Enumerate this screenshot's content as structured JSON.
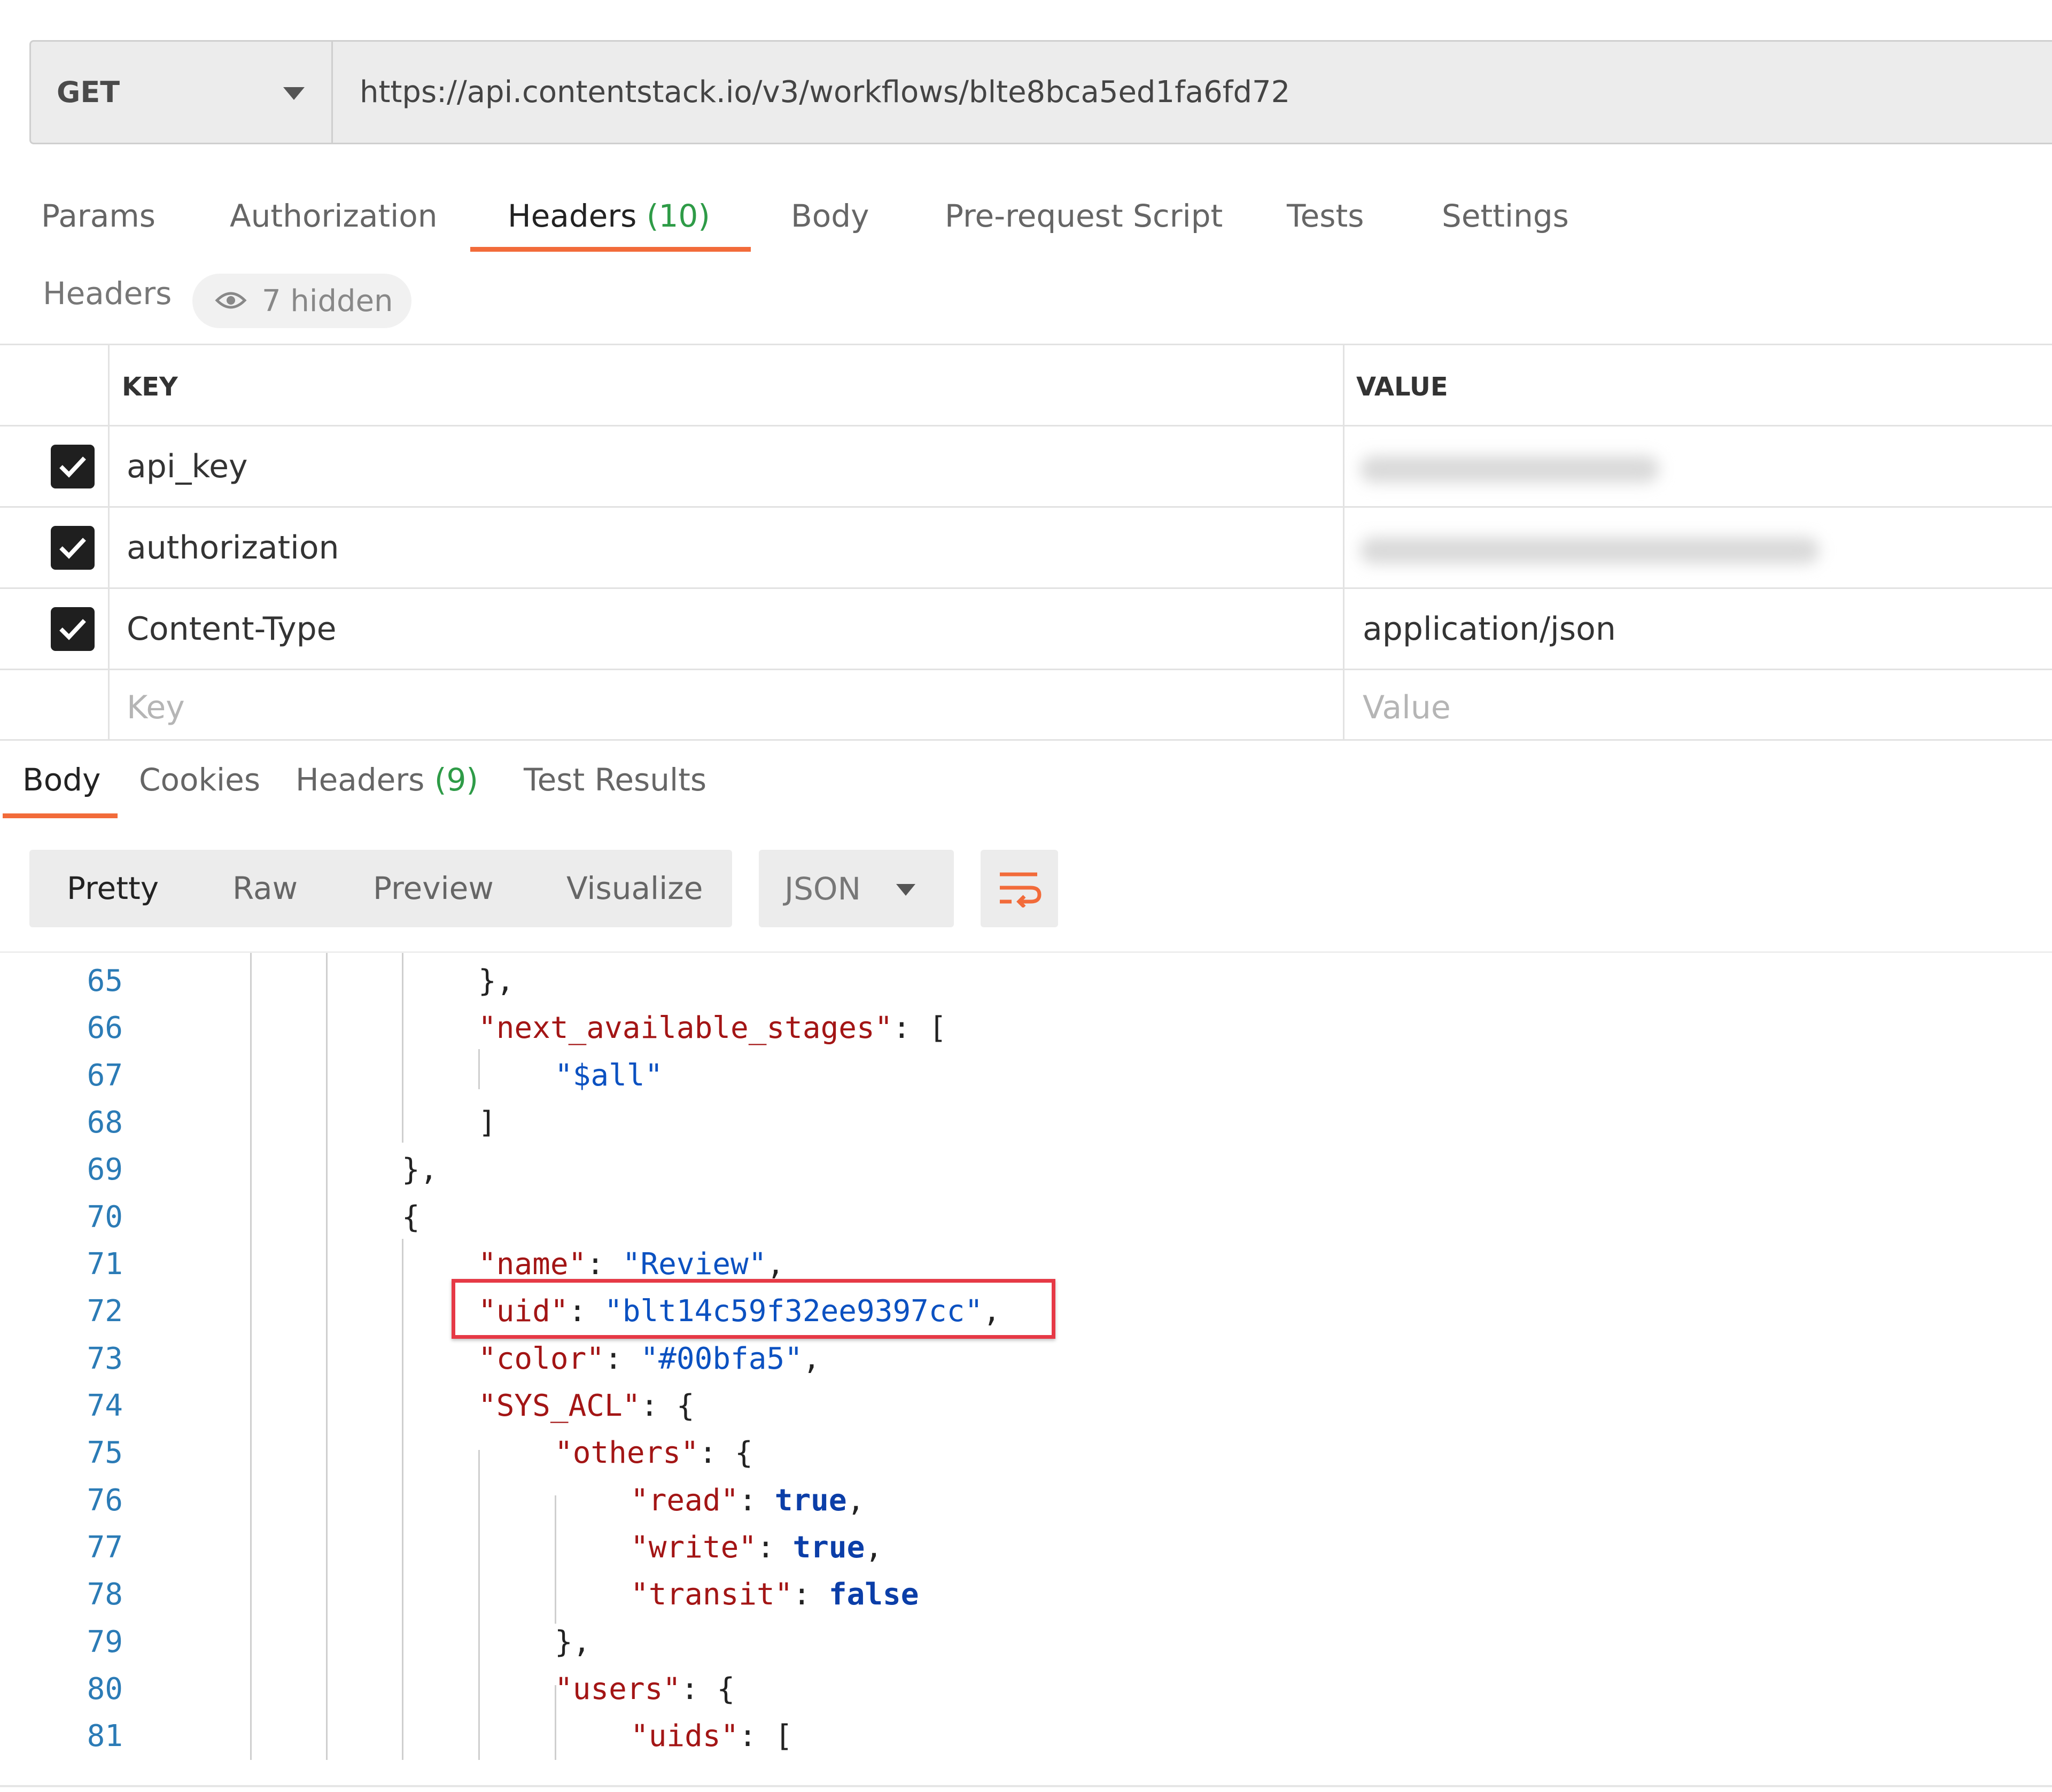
{
  "request": {
    "method": "GET",
    "url": "https://api.contentstack.io/v3/workflows/blte8bca5ed1fa6fd72"
  },
  "request_tabs": [
    {
      "label": "Params",
      "count": ""
    },
    {
      "label": "Authorization",
      "count": ""
    },
    {
      "label": "Headers",
      "count": "(10)"
    },
    {
      "label": "Body",
      "count": ""
    },
    {
      "label": "Pre-request Script",
      "count": ""
    },
    {
      "label": "Tests",
      "count": ""
    },
    {
      "label": "Settings",
      "count": ""
    }
  ],
  "headers_section": {
    "label": "Headers",
    "hidden_label": "7 hidden"
  },
  "headers_table": {
    "key_header": "KEY",
    "value_header": "VALUE",
    "rows": [
      {
        "checked": true,
        "key": "api_key",
        "value": ""
      },
      {
        "checked": true,
        "key": "authorization",
        "value": ""
      },
      {
        "checked": true,
        "key": "Content-Type",
        "value": "application/json"
      }
    ],
    "key_placeholder": "Key",
    "value_placeholder": "Value"
  },
  "response_tabs": [
    {
      "label": "Body",
      "count": ""
    },
    {
      "label": "Cookies",
      "count": ""
    },
    {
      "label": "Headers",
      "count": "(9)"
    },
    {
      "label": "Test Results",
      "count": ""
    }
  ],
  "view_modes": [
    "Pretty",
    "Raw",
    "Preview",
    "Visualize"
  ],
  "format": "JSON",
  "icons": {
    "method_dropdown": "chevron-down-icon",
    "hidden_headers": "eye-icon",
    "checkbox": "checkmark-icon",
    "format_dropdown": "chevron-down-icon",
    "wrap": "wrap-lines-icon"
  },
  "colors": {
    "accent": "#f26b3a",
    "count": "#2e9b47",
    "json_key": "#a31515",
    "json_string": "#0b51c1",
    "json_boolean": "#0b3ea8",
    "line_number": "#2b7bb6",
    "highlight_box": "#e63946"
  },
  "code_lines": [
    {
      "num": "65",
      "text": "},"
    },
    {
      "num": "66",
      "text": "\"next_available_stages\": ["
    },
    {
      "num": "67",
      "text": "\"$all\""
    },
    {
      "num": "68",
      "text": "]"
    },
    {
      "num": "69",
      "text": "},"
    },
    {
      "num": "70",
      "text": "{"
    },
    {
      "num": "71",
      "text": "\"name\": \"Review\","
    },
    {
      "num": "72",
      "text": "\"uid\": \"blt14c59f32ee9397cc\","
    },
    {
      "num": "73",
      "text": "\"color\": \"#00bfa5\","
    },
    {
      "num": "74",
      "text": "\"SYS_ACL\": {"
    },
    {
      "num": "75",
      "text": "\"others\": {"
    },
    {
      "num": "76",
      "text": "\"read\": true,"
    },
    {
      "num": "77",
      "text": "\"write\": true,"
    },
    {
      "num": "78",
      "text": "\"transit\": false"
    },
    {
      "num": "79",
      "text": "},"
    },
    {
      "num": "80",
      "text": "\"users\": {"
    },
    {
      "num": "81",
      "text": "\"uids\": ["
    }
  ],
  "code_tokens": {
    "k_next": "\"next_available_stages\"",
    "s_all": "\"$all\"",
    "k_name": "\"name\"",
    "s_review": "\"Review\"",
    "k_uid": "\"uid\"",
    "s_uid": "\"blt14c59f32ee9397cc\"",
    "k_color": "\"color\"",
    "s_color": "\"#00bfa5\"",
    "k_sysacl": "\"SYS_ACL\"",
    "k_others": "\"others\"",
    "k_read": "\"read\"",
    "b_read": "true",
    "k_write": "\"write\"",
    "b_write": "true",
    "k_transit": "\"transit\"",
    "b_transit": "false",
    "k_users": "\"users\"",
    "k_uids": "\"uids\""
  }
}
